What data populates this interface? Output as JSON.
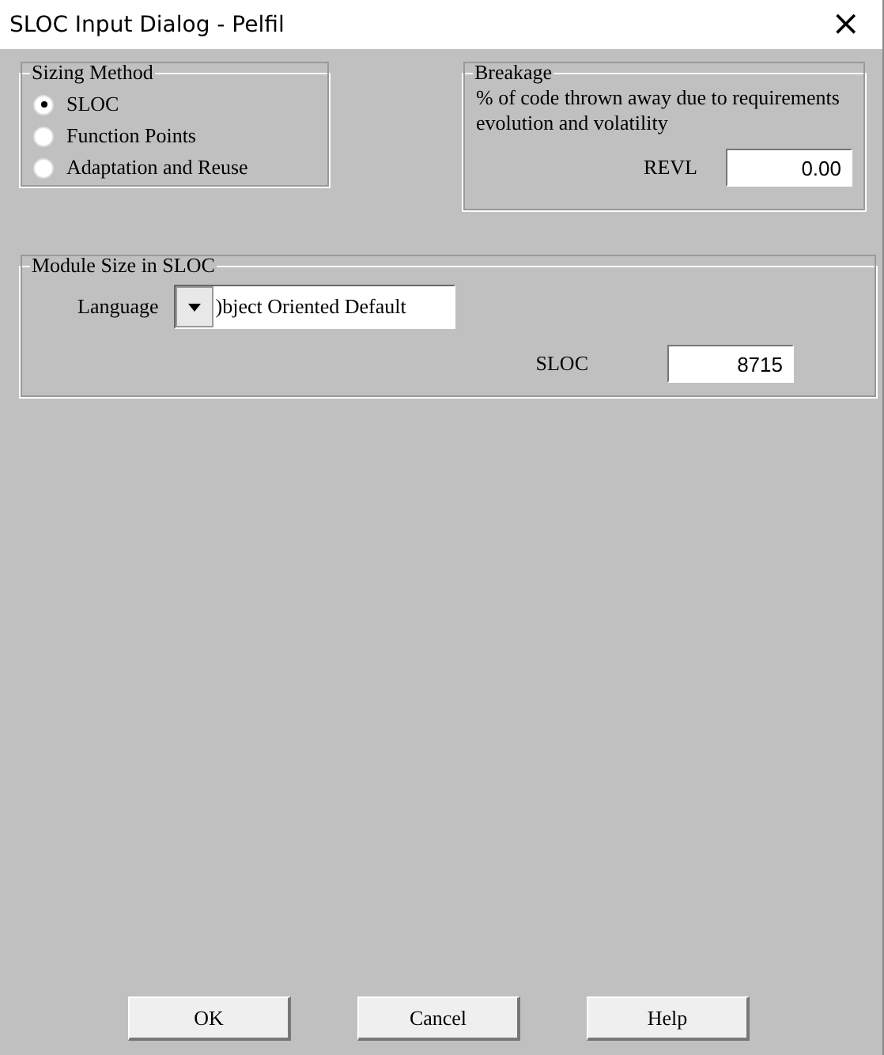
{
  "window": {
    "title": "SLOC Input Dialog - Pelfil",
    "close": "×"
  },
  "sizing_method": {
    "title": "Sizing Method",
    "options": [
      {
        "label": "SLOC",
        "selected": true
      },
      {
        "label": "Function Points",
        "selected": false
      },
      {
        "label": "Adaptation and Reuse",
        "selected": false
      }
    ]
  },
  "breakage": {
    "title": "Breakage",
    "description": "% of code thrown away due to requirements evolution and volatility",
    "field_label": "REVL",
    "value": "0.00"
  },
  "module_size": {
    "title": "Module Size in SLOC",
    "language_label": "Language",
    "language_value": ")bject Oriented Default",
    "sloc_label": "SLOC",
    "sloc_value": "8715"
  },
  "buttons": [
    "OK",
    "Cancel",
    "Help"
  ]
}
